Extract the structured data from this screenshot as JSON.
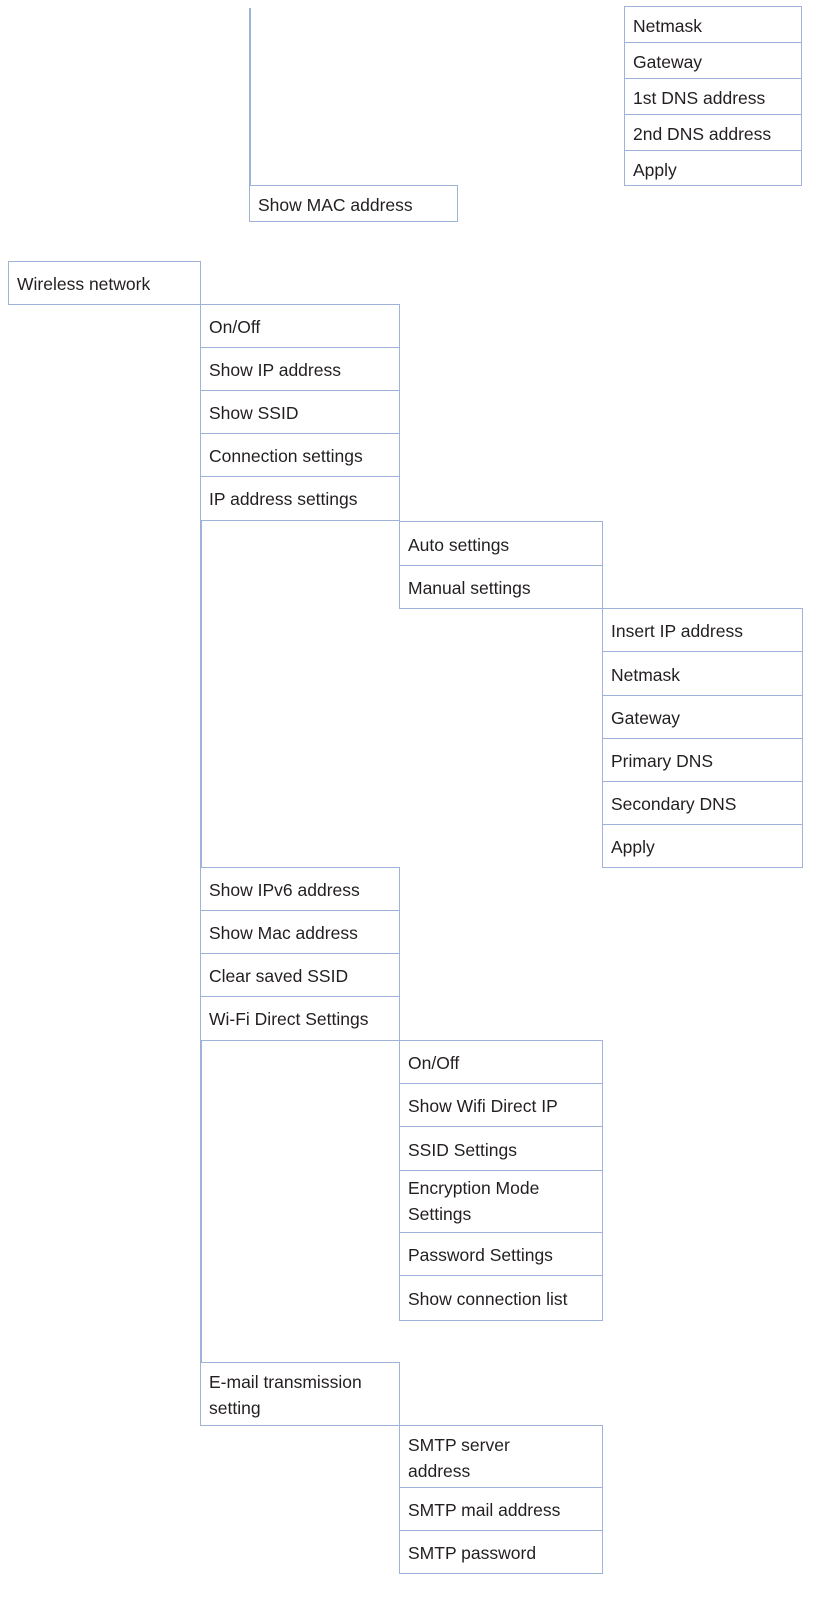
{
  "top": {
    "manual_settings_items": [
      "Netmask",
      "Gateway",
      "1st DNS address",
      "2nd DNS address",
      "Apply"
    ],
    "show_mac_address": "Show MAC address"
  },
  "wireless": {
    "title": "Wireless network",
    "items": {
      "on_off": "On/Off",
      "show_ip": "Show IP address",
      "show_ssid": "Show SSID",
      "connection_settings": "Connection settings",
      "ip_address_settings": "IP address settings",
      "show_ipv6": "Show IPv6 address",
      "show_mac": "Show Mac address",
      "clear_ssid": "Clear saved SSID",
      "wifi_direct": "Wi-Fi Direct Settings",
      "email_transmission": "E-mail transmission setting"
    },
    "ip_settings": {
      "auto": "Auto settings",
      "manual": "Manual settings",
      "manual_items": [
        "Insert IP address",
        "Netmask",
        "Gateway",
        "Primary DNS",
        "Secondary DNS",
        "Apply"
      ]
    },
    "wifi_direct_items": [
      "On/Off",
      "Show Wifi Direct IP",
      "SSID Settings",
      "Encryption Mode Settings",
      "Password Settings",
      "Show connection list"
    ],
    "email_items": [
      "SMTP server address",
      "SMTP mail address",
      "SMTP password"
    ]
  }
}
